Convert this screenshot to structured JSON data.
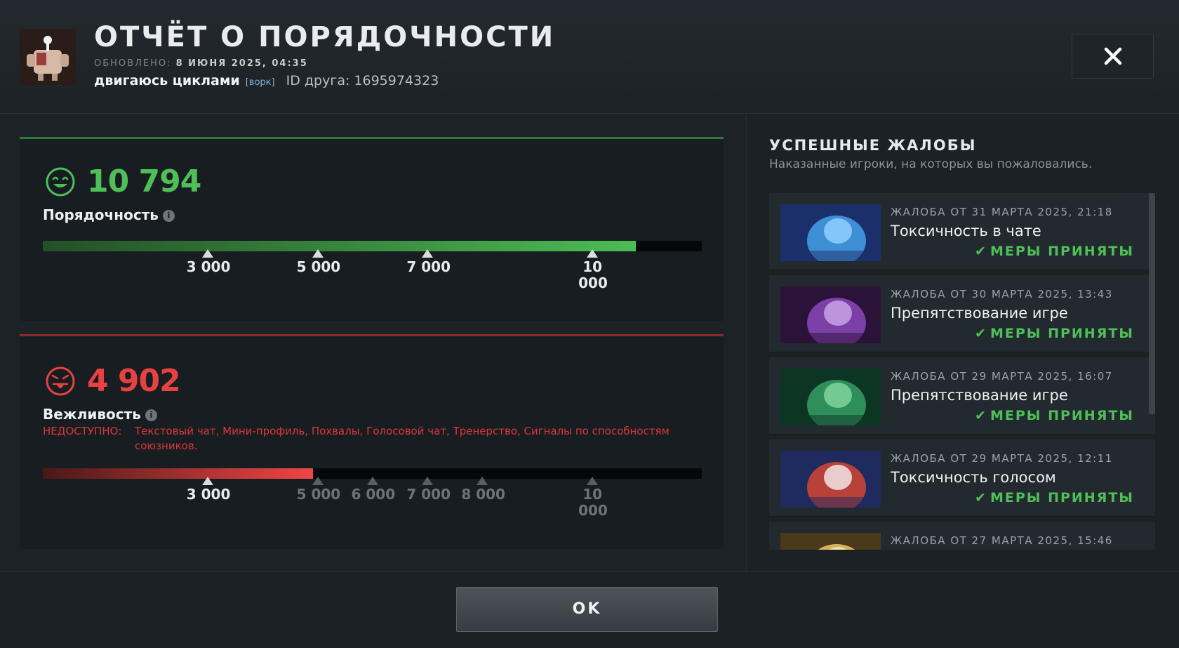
{
  "header": {
    "title": "ОТЧЁТ О ПОРЯДОЧНОСТИ",
    "updated_label": "ОБНОВЛЕНО:",
    "updated_value": "8 ИЮНЯ 2025, 04:35",
    "player_name": "двигаюсь циклами",
    "player_tag": "[ворк]",
    "friend_id": "ID друга: 1695974323",
    "close_icon": "close-icon"
  },
  "conduct": {
    "score": "10 794",
    "label": "Порядочность",
    "info_icon": "info-icon",
    "info_glyph": "i",
    "face_icon": "smiley-face-icon",
    "color": "#4fbf58",
    "fill_fraction": 0.9,
    "ticks": [
      {
        "label": "3 000",
        "pos": 0.25
      },
      {
        "label": "5 000",
        "pos": 0.417
      },
      {
        "label": "7 000",
        "pos": 0.584
      },
      {
        "label": "10 000",
        "pos": 0.834
      }
    ]
  },
  "behavior": {
    "score": "4 902",
    "label": "Вежливость",
    "info_icon": "info-icon",
    "info_glyph": "i",
    "face_icon": "angry-face-icon",
    "color": "#e84141",
    "fill_fraction": 0.41,
    "unavailable_label": "НЕДОСТУПНО:",
    "unavailable_text": "Текстовый чат, Мини-профиль, Похвалы, Голосовой чат, Тренерство, Сигналы по способностям союзников.",
    "ticks": [
      {
        "label": "3 000",
        "pos": 0.25
      },
      {
        "label": "5 000",
        "pos": 0.417
      },
      {
        "label": "6 000",
        "pos": 0.5
      },
      {
        "label": "7 000",
        "pos": 0.584
      },
      {
        "label": "8 000",
        "pos": 0.667
      },
      {
        "label": "10 000",
        "pos": 0.834
      }
    ]
  },
  "reports": {
    "title": "УСПЕШНЫЕ ЖАЛОБЫ",
    "subtitle": "Наказанные игроки, на которых вы пожаловались.",
    "status_icon": "checkmark-icon",
    "status_glyph": "✔",
    "items": [
      {
        "date": "ЖАЛОБА ОТ 31 МАРТА 2025, 21:18",
        "reason": "Токсичность в чате",
        "status": "МЕРЫ ПРИНЯТЫ",
        "image": "hero-portrait-blue"
      },
      {
        "date": "ЖАЛОБА ОТ 30 МАРТА 2025, 13:43",
        "reason": "Препятствование игре",
        "status": "МЕРЫ ПРИНЯТЫ",
        "image": "hero-portrait-purple"
      },
      {
        "date": "ЖАЛОБА ОТ 29 МАРТА 2025, 16:07",
        "reason": "Препятствование игре",
        "status": "МЕРЫ ПРИНЯТЫ",
        "image": "hero-portrait-green"
      },
      {
        "date": "ЖАЛОБА ОТ 29 МАРТА 2025, 12:11",
        "reason": "Токсичность голосом",
        "status": "МЕРЫ ПРИНЯТЫ",
        "image": "hero-portrait-red"
      },
      {
        "date": "ЖАЛОБА ОТ 27 МАРТА 2025, 15:46",
        "reason": "",
        "status": "",
        "image": "hero-portrait-gold"
      }
    ]
  },
  "footer": {
    "ok_label": "OK"
  }
}
